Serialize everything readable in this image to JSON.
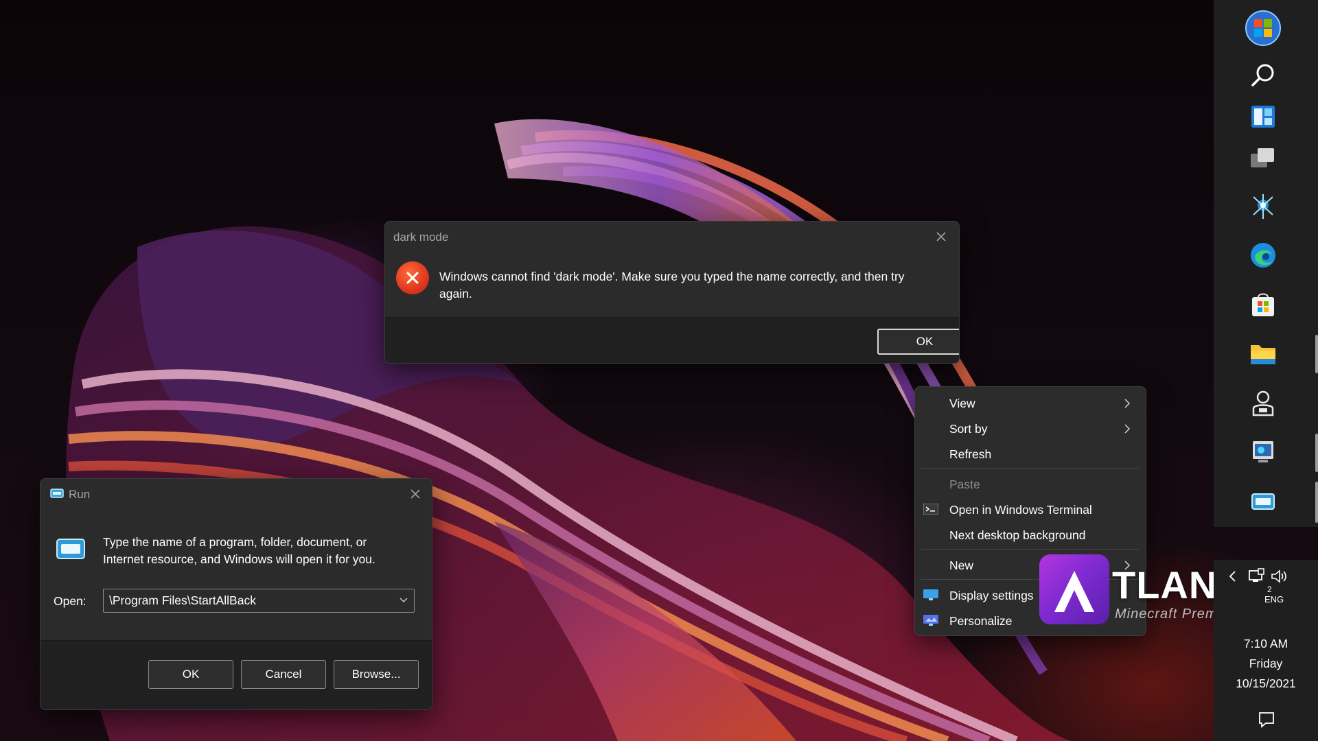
{
  "error_dialog": {
    "title": "dark mode",
    "message": "Windows cannot find 'dark mode'. Make sure you typed the name correctly, and then try again.",
    "ok_label": "OK",
    "icon": "error-icon"
  },
  "run_dialog": {
    "title": "Run",
    "description": "Type the name of a program, folder, document, or Internet resource, and Windows will open it for you.",
    "open_label": "Open:",
    "open_value": "\\Program Files\\StartAllBack",
    "ok_label": "OK",
    "cancel_label": "Cancel",
    "browse_label": "Browse..."
  },
  "context_menu": {
    "items": [
      {
        "label": "View",
        "submenu": true
      },
      {
        "label": "Sort by",
        "submenu": true
      },
      {
        "label": "Refresh"
      },
      {
        "label": "Paste",
        "disabled": true
      },
      {
        "label": "Open in Windows Terminal",
        "icon": "terminal-icon"
      },
      {
        "label": "Next desktop background"
      },
      {
        "label": "New",
        "submenu": true
      },
      {
        "label": "Display settings",
        "icon": "display-icon"
      },
      {
        "label": "Personalize",
        "icon": "personalize-icon"
      }
    ]
  },
  "watermark": {
    "wordmark": "TLANTIS",
    "tagline": "Minecraft Premium Forums"
  },
  "taskbar": {
    "apps": [
      {
        "name": "start-icon"
      },
      {
        "name": "search-icon"
      },
      {
        "name": "widgets-icon"
      },
      {
        "name": "task-view-icon"
      },
      {
        "name": "network-tool-icon"
      },
      {
        "name": "edge-icon"
      },
      {
        "name": "store-icon"
      },
      {
        "name": "file-explorer-icon"
      },
      {
        "name": "user-app-icon"
      },
      {
        "name": "remote-desktop-icon"
      },
      {
        "name": "run-icon"
      }
    ]
  },
  "tray": {
    "lang_top": "2",
    "lang": "ENG",
    "time": "7:10 AM",
    "day": "Friday",
    "date": "10/15/2021"
  },
  "colors": {
    "dialog_bg": "#2b2b2b",
    "dialog_footer": "#202020",
    "menu_bg": "#2c2c2c",
    "error_red": "#e0401f",
    "taskbar_bg": "#1f1f1f",
    "atlantis_purple": "#8a2ed6"
  }
}
